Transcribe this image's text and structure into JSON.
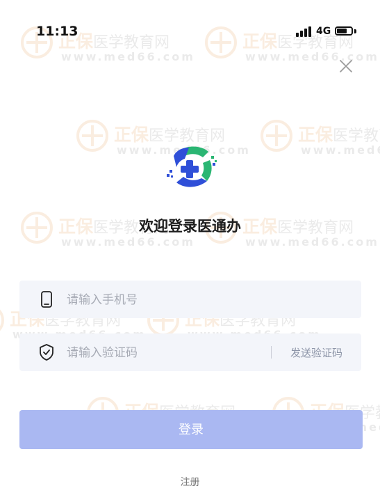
{
  "status_bar": {
    "time": "11:13",
    "network": "4G",
    "battery_level": 0.7
  },
  "watermark": {
    "brand": "正保",
    "brand_sub": "医学教育网",
    "site": "www.med66.com"
  },
  "close_icon": "close-icon",
  "logo_icon": "medical-cross-logo",
  "welcome_text": "欢迎登录医通办",
  "phone_field": {
    "icon": "phone-icon",
    "placeholder": "请输入手机号",
    "value": ""
  },
  "code_field": {
    "icon": "shield-check-icon",
    "placeholder": "请输入验证码",
    "value": "",
    "send_code_label": "发送验证码"
  },
  "login_button_label": "登录",
  "register_link_label": "注册",
  "colors": {
    "primary_disabled": "#aab8f2",
    "input_bg": "#f3f5fa",
    "logo_blue": "#2f4fd8",
    "logo_green": "#2bb673",
    "watermark_orange": "#e07c1d"
  }
}
